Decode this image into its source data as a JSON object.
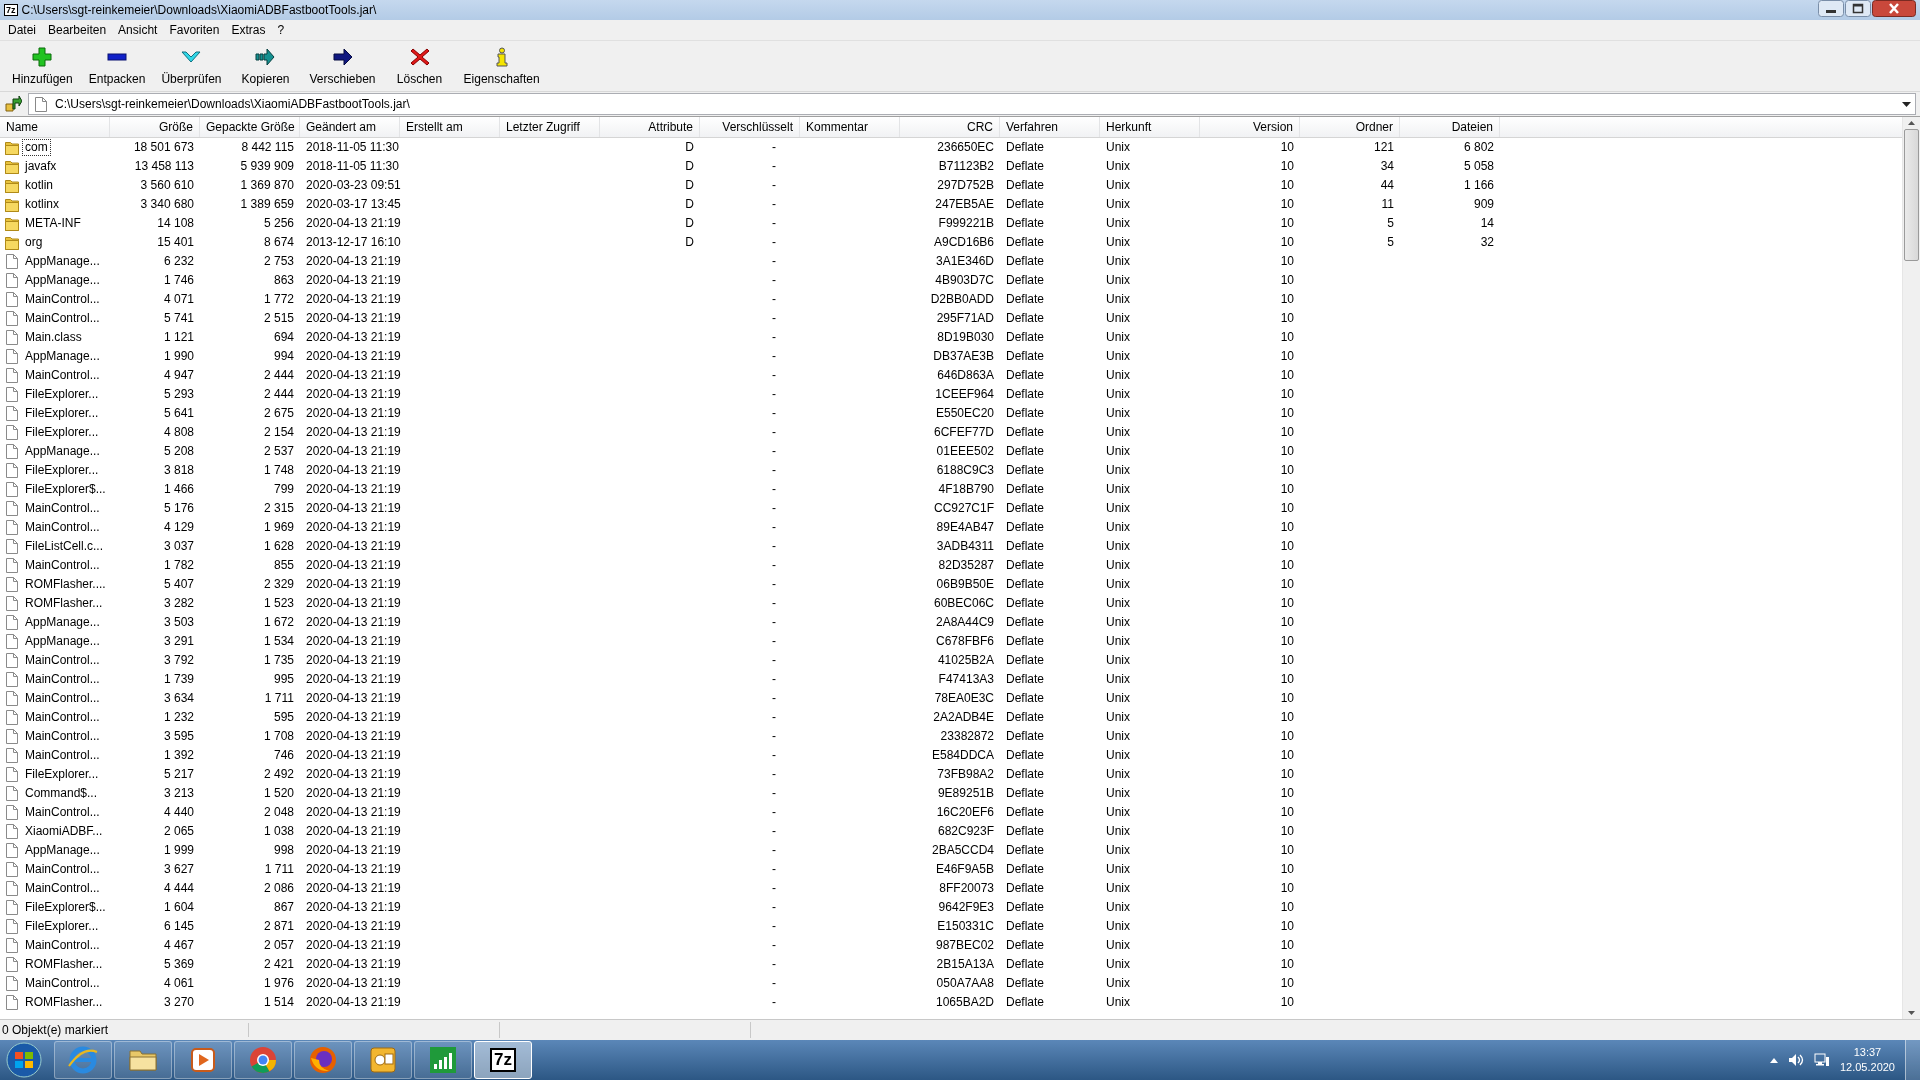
{
  "window": {
    "icon_text": "7z",
    "title": "C:\\Users\\sgt-reinkemeier\\Downloads\\XiaomiADBFastbootTools.jar\\"
  },
  "menu": [
    "Datei",
    "Bearbeiten",
    "Ansicht",
    "Favoriten",
    "Extras",
    "?"
  ],
  "toolbar": [
    {
      "kind": "add",
      "label": "Hinzufügen"
    },
    {
      "kind": "extract",
      "label": "Entpacken"
    },
    {
      "kind": "test",
      "label": "Überprüfen"
    },
    {
      "kind": "copy",
      "label": "Kopieren"
    },
    {
      "kind": "move",
      "label": "Verschieben"
    },
    {
      "kind": "delete",
      "label": "Löschen"
    },
    {
      "kind": "info",
      "label": "Eigenschaften"
    }
  ],
  "address": {
    "value": "C:\\Users\\sgt-reinkemeier\\Downloads\\XiaomiADBFastbootTools.jar\\"
  },
  "table": {
    "columns": [
      "Name",
      "Größe",
      "Gepackte Größe",
      "Geändert am",
      "Erstellt am",
      "Letzter Zugriff",
      "Attribute",
      "Verschlüsselt",
      "Kommentar",
      "CRC",
      "Verfahren",
      "Herkunft",
      "Version",
      "Ordner",
      "Dateien"
    ],
    "rows": [
      {
        "kind": "folder",
        "focused": true,
        "name": "com",
        "size": "18 501 673",
        "packed": "8 442 115",
        "modified": "2018-11-05 11:30",
        "attributes": "D",
        "encrypted": "-",
        "crc": "236650EC",
        "method": "Deflate",
        "host": "Unix",
        "version": "10",
        "folders": "121",
        "files": "6 802"
      },
      {
        "kind": "folder",
        "focused": false,
        "name": "javafx",
        "size": "13 458 113",
        "packed": "5 939 909",
        "modified": "2018-11-05 11:30",
        "attributes": "D",
        "encrypted": "-",
        "crc": "B71123B2",
        "method": "Deflate",
        "host": "Unix",
        "version": "10",
        "folders": "34",
        "files": "5 058"
      },
      {
        "kind": "folder",
        "focused": false,
        "name": "kotlin",
        "size": "3 560 610",
        "packed": "1 369 870",
        "modified": "2020-03-23 09:51",
        "attributes": "D",
        "encrypted": "-",
        "crc": "297D752B",
        "method": "Deflate",
        "host": "Unix",
        "version": "10",
        "folders": "44",
        "files": "1 166"
      },
      {
        "kind": "folder",
        "focused": false,
        "name": "kotlinx",
        "size": "3 340 680",
        "packed": "1 389 659",
        "modified": "2020-03-17 13:45",
        "attributes": "D",
        "encrypted": "-",
        "crc": "247EB5AE",
        "method": "Deflate",
        "host": "Unix",
        "version": "10",
        "folders": "11",
        "files": "909"
      },
      {
        "kind": "folder",
        "focused": false,
        "name": "META-INF",
        "size": "14 108",
        "packed": "5 256",
        "modified": "2020-04-13 21:19",
        "attributes": "D",
        "encrypted": "-",
        "crc": "F999221B",
        "method": "Deflate",
        "host": "Unix",
        "version": "10",
        "folders": "5",
        "files": "14"
      },
      {
        "kind": "folder",
        "focused": false,
        "name": "org",
        "size": "15 401",
        "packed": "8 674",
        "modified": "2013-12-17 16:10",
        "attributes": "D",
        "encrypted": "-",
        "crc": "A9CD16B6",
        "method": "Deflate",
        "host": "Unix",
        "version": "10",
        "folders": "5",
        "files": "32"
      },
      {
        "kind": "file",
        "focused": false,
        "name": "AppManage...",
        "size": "6 232",
        "packed": "2 753",
        "modified": "2020-04-13 21:19",
        "encrypted": "-",
        "crc": "3A1E346D",
        "method": "Deflate",
        "host": "Unix",
        "version": "10"
      },
      {
        "kind": "file",
        "focused": false,
        "name": "AppManage...",
        "size": "1 746",
        "packed": "863",
        "modified": "2020-04-13 21:19",
        "encrypted": "-",
        "crc": "4B903D7C",
        "method": "Deflate",
        "host": "Unix",
        "version": "10"
      },
      {
        "kind": "file",
        "focused": false,
        "name": "MainControl...",
        "size": "4 071",
        "packed": "1 772",
        "modified": "2020-04-13 21:19",
        "encrypted": "-",
        "crc": "D2BB0ADD",
        "method": "Deflate",
        "host": "Unix",
        "version": "10"
      },
      {
        "kind": "file",
        "focused": false,
        "name": "MainControl...",
        "size": "5 741",
        "packed": "2 515",
        "modified": "2020-04-13 21:19",
        "encrypted": "-",
        "crc": "295F71AD",
        "method": "Deflate",
        "host": "Unix",
        "version": "10"
      },
      {
        "kind": "file",
        "focused": false,
        "name": "Main.class",
        "size": "1 121",
        "packed": "694",
        "modified": "2020-04-13 21:19",
        "encrypted": "-",
        "crc": "8D19B030",
        "method": "Deflate",
        "host": "Unix",
        "version": "10"
      },
      {
        "kind": "file",
        "focused": false,
        "name": "AppManage...",
        "size": "1 990",
        "packed": "994",
        "modified": "2020-04-13 21:19",
        "encrypted": "-",
        "crc": "DB37AE3B",
        "method": "Deflate",
        "host": "Unix",
        "version": "10"
      },
      {
        "kind": "file",
        "focused": false,
        "name": "MainControl...",
        "size": "4 947",
        "packed": "2 444",
        "modified": "2020-04-13 21:19",
        "encrypted": "-",
        "crc": "646D863A",
        "method": "Deflate",
        "host": "Unix",
        "version": "10"
      },
      {
        "kind": "file",
        "focused": false,
        "name": "FileExplorer...",
        "size": "5 293",
        "packed": "2 444",
        "modified": "2020-04-13 21:19",
        "encrypted": "-",
        "crc": "1CEEF964",
        "method": "Deflate",
        "host": "Unix",
        "version": "10"
      },
      {
        "kind": "file",
        "focused": false,
        "name": "FileExplorer...",
        "size": "5 641",
        "packed": "2 675",
        "modified": "2020-04-13 21:19",
        "encrypted": "-",
        "crc": "E550EC20",
        "method": "Deflate",
        "host": "Unix",
        "version": "10"
      },
      {
        "kind": "file",
        "focused": false,
        "name": "FileExplorer...",
        "size": "4 808",
        "packed": "2 154",
        "modified": "2020-04-13 21:19",
        "encrypted": "-",
        "crc": "6CFEF77D",
        "method": "Deflate",
        "host": "Unix",
        "version": "10"
      },
      {
        "kind": "file",
        "focused": false,
        "name": "AppManage...",
        "size": "5 208",
        "packed": "2 537",
        "modified": "2020-04-13 21:19",
        "encrypted": "-",
        "crc": "01EEE502",
        "method": "Deflate",
        "host": "Unix",
        "version": "10"
      },
      {
        "kind": "file",
        "focused": false,
        "name": "FileExplorer...",
        "size": "3 818",
        "packed": "1 748",
        "modified": "2020-04-13 21:19",
        "encrypted": "-",
        "crc": "6188C9C3",
        "method": "Deflate",
        "host": "Unix",
        "version": "10"
      },
      {
        "kind": "file",
        "focused": false,
        "name": "FileExplorer$...",
        "size": "1 466",
        "packed": "799",
        "modified": "2020-04-13 21:19",
        "encrypted": "-",
        "crc": "4F18B790",
        "method": "Deflate",
        "host": "Unix",
        "version": "10"
      },
      {
        "kind": "file",
        "focused": false,
        "name": "MainControl...",
        "size": "5 176",
        "packed": "2 315",
        "modified": "2020-04-13 21:19",
        "encrypted": "-",
        "crc": "CC927C1F",
        "method": "Deflate",
        "host": "Unix",
        "version": "10"
      },
      {
        "kind": "file",
        "focused": false,
        "name": "MainControl...",
        "size": "4 129",
        "packed": "1 969",
        "modified": "2020-04-13 21:19",
        "encrypted": "-",
        "crc": "89E4AB47",
        "method": "Deflate",
        "host": "Unix",
        "version": "10"
      },
      {
        "kind": "file",
        "focused": false,
        "name": "FileListCell.c...",
        "size": "3 037",
        "packed": "1 628",
        "modified": "2020-04-13 21:19",
        "encrypted": "-",
        "crc": "3ADB4311",
        "method": "Deflate",
        "host": "Unix",
        "version": "10"
      },
      {
        "kind": "file",
        "focused": false,
        "name": "MainControl...",
        "size": "1 782",
        "packed": "855",
        "modified": "2020-04-13 21:19",
        "encrypted": "-",
        "crc": "82D35287",
        "method": "Deflate",
        "host": "Unix",
        "version": "10"
      },
      {
        "kind": "file",
        "focused": false,
        "name": "ROMFlasher....",
        "size": "5 407",
        "packed": "2 329",
        "modified": "2020-04-13 21:19",
        "encrypted": "-",
        "crc": "06B9B50E",
        "method": "Deflate",
        "host": "Unix",
        "version": "10"
      },
      {
        "kind": "file",
        "focused": false,
        "name": "ROMFlasher...",
        "size": "3 282",
        "packed": "1 523",
        "modified": "2020-04-13 21:19",
        "encrypted": "-",
        "crc": "60BEC06C",
        "method": "Deflate",
        "host": "Unix",
        "version": "10"
      },
      {
        "kind": "file",
        "focused": false,
        "name": "AppManage...",
        "size": "3 503",
        "packed": "1 672",
        "modified": "2020-04-13 21:19",
        "encrypted": "-",
        "crc": "2A8A44C9",
        "method": "Deflate",
        "host": "Unix",
        "version": "10"
      },
      {
        "kind": "file",
        "focused": false,
        "name": "AppManage...",
        "size": "3 291",
        "packed": "1 534",
        "modified": "2020-04-13 21:19",
        "encrypted": "-",
        "crc": "C678FBF6",
        "method": "Deflate",
        "host": "Unix",
        "version": "10"
      },
      {
        "kind": "file",
        "focused": false,
        "name": "MainControl...",
        "size": "3 792",
        "packed": "1 735",
        "modified": "2020-04-13 21:19",
        "encrypted": "-",
        "crc": "41025B2A",
        "method": "Deflate",
        "host": "Unix",
        "version": "10"
      },
      {
        "kind": "file",
        "focused": false,
        "name": "MainControl...",
        "size": "1 739",
        "packed": "995",
        "modified": "2020-04-13 21:19",
        "encrypted": "-",
        "crc": "F47413A3",
        "method": "Deflate",
        "host": "Unix",
        "version": "10"
      },
      {
        "kind": "file",
        "focused": false,
        "name": "MainControl...",
        "size": "3 634",
        "packed": "1 711",
        "modified": "2020-04-13 21:19",
        "encrypted": "-",
        "crc": "78EA0E3C",
        "method": "Deflate",
        "host": "Unix",
        "version": "10"
      },
      {
        "kind": "file",
        "focused": false,
        "name": "MainControl...",
        "size": "1 232",
        "packed": "595",
        "modified": "2020-04-13 21:19",
        "encrypted": "-",
        "crc": "2A2ADB4E",
        "method": "Deflate",
        "host": "Unix",
        "version": "10"
      },
      {
        "kind": "file",
        "focused": false,
        "name": "MainControl...",
        "size": "3 595",
        "packed": "1 708",
        "modified": "2020-04-13 21:19",
        "encrypted": "-",
        "crc": "23382872",
        "method": "Deflate",
        "host": "Unix",
        "version": "10"
      },
      {
        "kind": "file",
        "focused": false,
        "name": "MainControl...",
        "size": "1 392",
        "packed": "746",
        "modified": "2020-04-13 21:19",
        "encrypted": "-",
        "crc": "E584DDCA",
        "method": "Deflate",
        "host": "Unix",
        "version": "10"
      },
      {
        "kind": "file",
        "focused": false,
        "name": "FileExplorer...",
        "size": "5 217",
        "packed": "2 492",
        "modified": "2020-04-13 21:19",
        "encrypted": "-",
        "crc": "73FB98A2",
        "method": "Deflate",
        "host": "Unix",
        "version": "10"
      },
      {
        "kind": "file",
        "focused": false,
        "name": "Command$...",
        "size": "3 213",
        "packed": "1 520",
        "modified": "2020-04-13 21:19",
        "encrypted": "-",
        "crc": "9E89251B",
        "method": "Deflate",
        "host": "Unix",
        "version": "10"
      },
      {
        "kind": "file",
        "focused": false,
        "name": "MainControl...",
        "size": "4 440",
        "packed": "2 048",
        "modified": "2020-04-13 21:19",
        "encrypted": "-",
        "crc": "16C20EF6",
        "method": "Deflate",
        "host": "Unix",
        "version": "10"
      },
      {
        "kind": "file",
        "focused": false,
        "name": "XiaomiADBF...",
        "size": "2 065",
        "packed": "1 038",
        "modified": "2020-04-13 21:19",
        "encrypted": "-",
        "crc": "682C923F",
        "method": "Deflate",
        "host": "Unix",
        "version": "10"
      },
      {
        "kind": "file",
        "focused": false,
        "name": "AppManage...",
        "size": "1 999",
        "packed": "998",
        "modified": "2020-04-13 21:19",
        "encrypted": "-",
        "crc": "2BA5CCD4",
        "method": "Deflate",
        "host": "Unix",
        "version": "10"
      },
      {
        "kind": "file",
        "focused": false,
        "name": "MainControl...",
        "size": "3 627",
        "packed": "1 711",
        "modified": "2020-04-13 21:19",
        "encrypted": "-",
        "crc": "E46F9A5B",
        "method": "Deflate",
        "host": "Unix",
        "version": "10"
      },
      {
        "kind": "file",
        "focused": false,
        "name": "MainControl...",
        "size": "4 444",
        "packed": "2 086",
        "modified": "2020-04-13 21:19",
        "encrypted": "-",
        "crc": "8FF20073",
        "method": "Deflate",
        "host": "Unix",
        "version": "10"
      },
      {
        "kind": "file",
        "focused": false,
        "name": "FileExplorer$...",
        "size": "1 604",
        "packed": "867",
        "modified": "2020-04-13 21:19",
        "encrypted": "-",
        "crc": "9642F9E3",
        "method": "Deflate",
        "host": "Unix",
        "version": "10"
      },
      {
        "kind": "file",
        "focused": false,
        "name": "FileExplorer...",
        "size": "6 145",
        "packed": "2 871",
        "modified": "2020-04-13 21:19",
        "encrypted": "-",
        "crc": "E150331C",
        "method": "Deflate",
        "host": "Unix",
        "version": "10"
      },
      {
        "kind": "file",
        "focused": false,
        "name": "MainControl...",
        "size": "4 467",
        "packed": "2 057",
        "modified": "2020-04-13 21:19",
        "encrypted": "-",
        "crc": "987BEC02",
        "method": "Deflate",
        "host": "Unix",
        "version": "10"
      },
      {
        "kind": "file",
        "focused": false,
        "name": "ROMFlasher...",
        "size": "5 369",
        "packed": "2 421",
        "modified": "2020-04-13 21:19",
        "encrypted": "-",
        "crc": "2B15A13A",
        "method": "Deflate",
        "host": "Unix",
        "version": "10"
      },
      {
        "kind": "file",
        "focused": false,
        "name": "MainControl...",
        "size": "4 061",
        "packed": "1 976",
        "modified": "2020-04-13 21:19",
        "encrypted": "-",
        "crc": "050A7AA8",
        "method": "Deflate",
        "host": "Unix",
        "version": "10"
      },
      {
        "kind": "file",
        "focused": false,
        "name": "ROMFlasher...",
        "size": "3 270",
        "packed": "1 514",
        "modified": "2020-04-13 21:19",
        "encrypted": "-",
        "crc": "1065BA2D",
        "method": "Deflate",
        "host": "Unix",
        "version": "10"
      }
    ]
  },
  "status_bar": "0 Objekt(e) markiert",
  "taskbar": {
    "apps": [
      {
        "kind": "ie",
        "active": false
      },
      {
        "kind": "folder",
        "active": false
      },
      {
        "kind": "media",
        "active": false
      },
      {
        "kind": "chrome",
        "active": false
      },
      {
        "kind": "firefox",
        "active": false
      },
      {
        "kind": "mail",
        "active": false
      },
      {
        "kind": "chart",
        "active": false
      },
      {
        "kind": "sevenzip",
        "active": true,
        "text": "7z"
      }
    ],
    "time": "13:37",
    "date": "12.05.2020"
  }
}
